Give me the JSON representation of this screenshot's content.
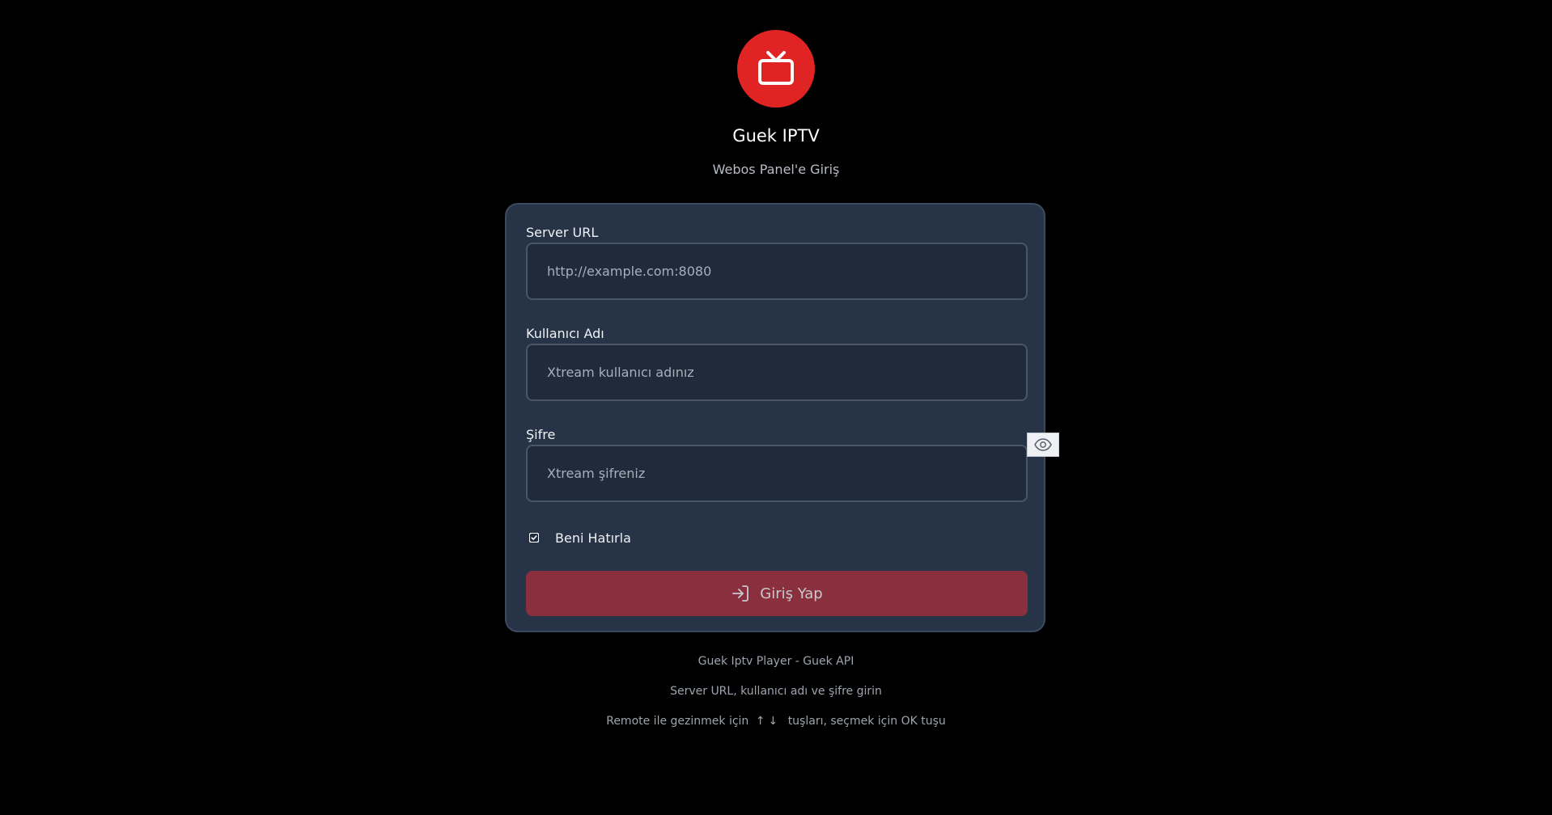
{
  "app": {
    "title": "Guek IPTV",
    "subtitle": "Webos Panel'e Giriş",
    "logo_icon": "tv-icon",
    "accent_color": "#e02424"
  },
  "form": {
    "server_url": {
      "label": "Server URL",
      "placeholder": "http://example.com:8080",
      "value": ""
    },
    "username": {
      "label": "Kullanıcı Adı",
      "placeholder": "Xtream kullanıcı adınız",
      "value": ""
    },
    "password": {
      "label": "Şifre",
      "placeholder": "Xtream şifreniz",
      "value": "",
      "toggle_icon": "eye-icon"
    },
    "remember": {
      "label": "Beni Hatırla",
      "checked": true
    },
    "submit": {
      "label": "Giriş Yap",
      "icon": "login-icon",
      "color": "#8a2f3d"
    }
  },
  "footer": {
    "line1": "Guek Iptv Player - Guek API",
    "line2": "Server URL, kullanıcı adı ve şifre girin",
    "line3_prefix": "Remote ile gezinmek için",
    "line3_arrows": "↑↓",
    "line3_suffix": "tuşları, seçmek için OK tuşu"
  }
}
